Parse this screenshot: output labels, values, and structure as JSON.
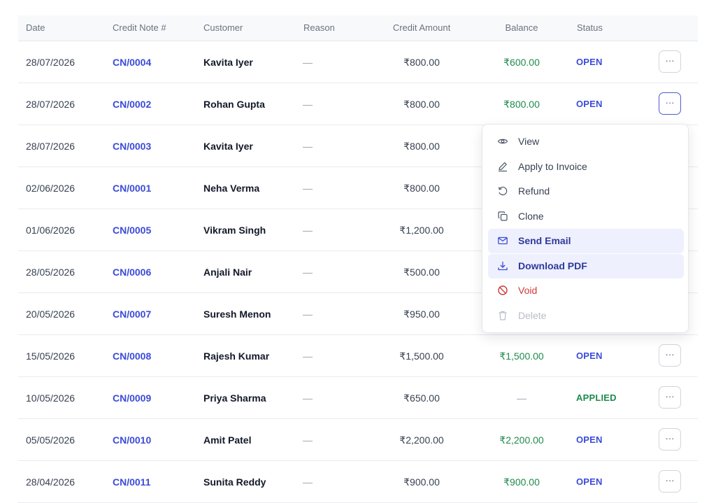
{
  "table": {
    "headers": {
      "date": "Date",
      "credit_note": "Credit Note #",
      "customer": "Customer",
      "reason": "Reason",
      "credit_amount": "Credit Amount",
      "balance": "Balance",
      "status": "Status"
    },
    "rows": [
      {
        "date": "28/07/2026",
        "cn": "CN/0004",
        "customer": "Kavita Iyer",
        "reason": "—",
        "amount": "₹800.00",
        "balance": "₹600.00",
        "status": "OPEN"
      },
      {
        "date": "28/07/2026",
        "cn": "CN/0002",
        "customer": "Rohan Gupta",
        "reason": "—",
        "amount": "₹800.00",
        "balance": "₹800.00",
        "status": "OPEN"
      },
      {
        "date": "28/07/2026",
        "cn": "CN/0003",
        "customer": "Kavita Iyer",
        "reason": "—",
        "amount": "₹800.00"
      },
      {
        "date": "02/06/2026",
        "cn": "CN/0001",
        "customer": "Neha Verma",
        "reason": "—",
        "amount": "₹800.00"
      },
      {
        "date": "01/06/2026",
        "cn": "CN/0005",
        "customer": "Vikram Singh",
        "reason": "—",
        "amount": "₹1,200.00"
      },
      {
        "date": "28/05/2026",
        "cn": "CN/0006",
        "customer": "Anjali Nair",
        "reason": "—",
        "amount": "₹500.00"
      },
      {
        "date": "20/05/2026",
        "cn": "CN/0007",
        "customer": "Suresh Menon",
        "reason": "—",
        "amount": "₹950.00"
      },
      {
        "date": "15/05/2026",
        "cn": "CN/0008",
        "customer": "Rajesh Kumar",
        "reason": "—",
        "amount": "₹1,500.00",
        "balance": "₹1,500.00",
        "status": "OPEN"
      },
      {
        "date": "10/05/2026",
        "cn": "CN/0009",
        "customer": "Priya Sharma",
        "reason": "—",
        "amount": "₹650.00",
        "balance": "—",
        "status": "APPLIED"
      },
      {
        "date": "05/05/2026",
        "cn": "CN/0010",
        "customer": "Amit Patel",
        "reason": "—",
        "amount": "₹2,200.00",
        "balance": "₹2,200.00",
        "status": "OPEN"
      },
      {
        "date": "28/04/2026",
        "cn": "CN/0011",
        "customer": "Sunita Reddy",
        "reason": "—",
        "amount": "₹900.00",
        "balance": "₹900.00",
        "status": "OPEN"
      }
    ],
    "more_glyph": "···"
  },
  "menu": {
    "items": [
      {
        "label": "View",
        "icon": "eye-icon"
      },
      {
        "label": "Apply to Invoice",
        "icon": "pencil-icon"
      },
      {
        "label": "Refund",
        "icon": "undo-icon"
      },
      {
        "label": "Clone",
        "icon": "copy-icon"
      },
      {
        "label": "Send Email",
        "icon": "mail-icon"
      },
      {
        "label": "Download PDF",
        "icon": "download-icon"
      },
      {
        "label": "Void",
        "icon": "ban-icon"
      },
      {
        "label": "Delete",
        "icon": "trash-icon"
      }
    ]
  },
  "colors": {
    "link": "#3b4bd8",
    "positive": "#1f8a4c",
    "danger": "#d03a3a",
    "highlight": "#eef0fd"
  }
}
